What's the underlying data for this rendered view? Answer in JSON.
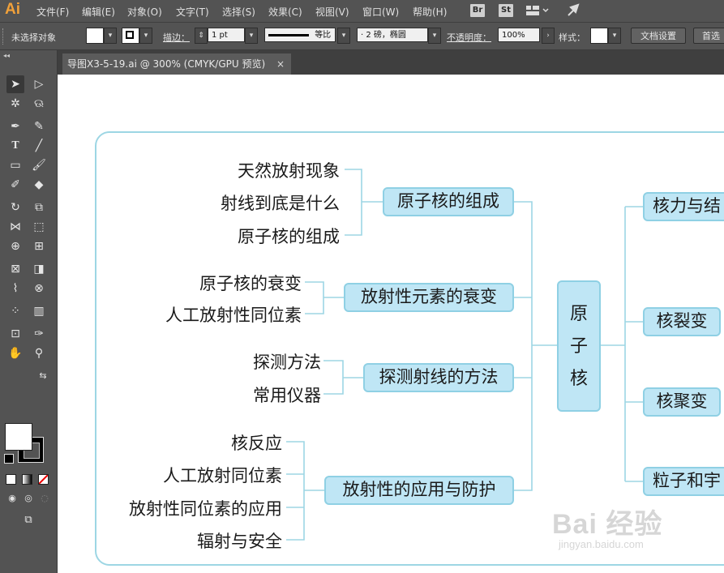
{
  "app": {
    "logo": "Ai",
    "menus": [
      "文件(F)",
      "编辑(E)",
      "对象(O)",
      "文字(T)",
      "选择(S)",
      "效果(C)",
      "视图(V)",
      "窗口(W)",
      "帮助(H)"
    ],
    "bridge_label": "Br",
    "stock_label": "St"
  },
  "controlbar": {
    "selection_status": "未选择对象",
    "stroke_label": "描边：",
    "stroke_weight": "1 pt",
    "profile_label": "等比",
    "brush_label": "· 2 磅，椭圆",
    "opacity_label": "不透明度：",
    "opacity_value": "100%",
    "style_label": "样式：",
    "doc_setup_button": "文档设置",
    "prefs_button": "首选"
  },
  "document": {
    "tab_title": "导图X3-5-19.ai @ 300% (CMYK/GPU 预览)",
    "close_glyph": "×"
  },
  "mindmap": {
    "center": "原子核",
    "groups": [
      {
        "label": "原子核的组成",
        "leaves": [
          "天然放射现象",
          "射线到底是什么",
          "原子核的组成"
        ]
      },
      {
        "label": "放射性元素的衰变",
        "leaves": [
          "原子核的衰变",
          "人工放射性同位素"
        ]
      },
      {
        "label": "探测射线的方法",
        "leaves": [
          "探测方法",
          "常用仪器"
        ]
      },
      {
        "label": "放射性的应用与防护",
        "leaves": [
          "核反应",
          "人工放射同位素",
          "放射性同位素的应用",
          "辐射与安全"
        ]
      }
    ],
    "right_branches": [
      "核力与结",
      "核裂变",
      "核聚变",
      "粒子和宇"
    ]
  },
  "watermark": {
    "brand": "Bai 经验",
    "url": "jingyan.baidu.com"
  },
  "colors": {
    "node_fill": "#bfe6f5",
    "node_border": "#8fd0e4",
    "line": "#9dd6e4",
    "ai_orange": "#f1a13a"
  }
}
